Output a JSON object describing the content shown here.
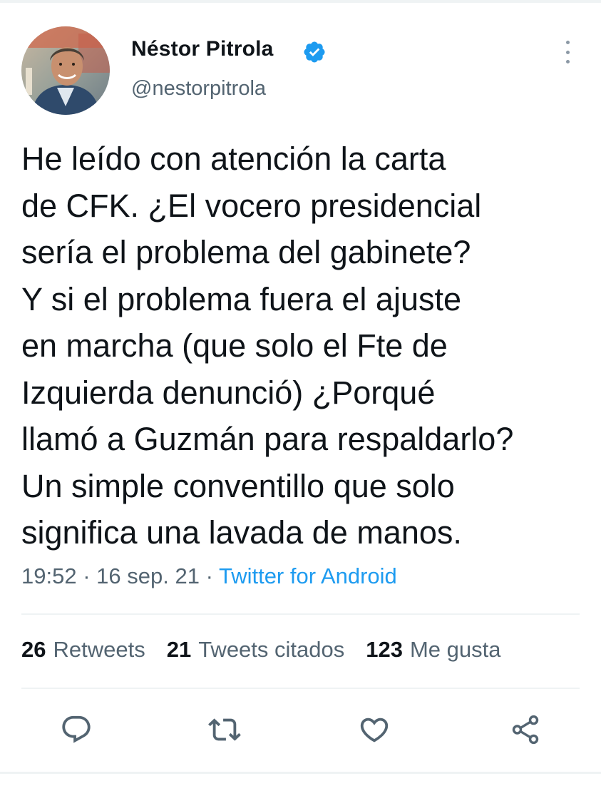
{
  "tweet": {
    "author_name": "Néstor Pitrola",
    "handle": "@nestorpitrola",
    "text_lines": [
      "He leído con atención la carta",
      "de CFK. ¿El vocero presidencial",
      "sería el problema del gabinete?",
      "Y si el problema fuera el ajuste",
      "en marcha (que solo el Fte de",
      "Izquierda denunció) ¿Porqué",
      "llamó a Guzmán para respaldarlo?",
      "Un simple conventillo que solo",
      "significa una lavada de manos."
    ],
    "time": "19:52",
    "separator": "·",
    "date": "16 sep. 21",
    "source": "Twitter for Android"
  },
  "stats": {
    "retweets": {
      "count": "26",
      "label": "Retweets"
    },
    "quotes": {
      "count": "21",
      "label": "Tweets citados"
    },
    "likes": {
      "count": "123",
      "label": "Me gusta"
    }
  },
  "icons": {
    "verified": "verified-badge-icon",
    "more": "more-options-icon",
    "reply": "reply-icon",
    "retweet": "retweet-icon",
    "like": "heart-icon",
    "share": "share-icon"
  },
  "colors": {
    "verified_blue": "#1d9bf0",
    "link_blue": "#1d9bf0",
    "secondary_text": "#536471",
    "primary_text": "#0f1419",
    "divider": "#eff3f4"
  }
}
